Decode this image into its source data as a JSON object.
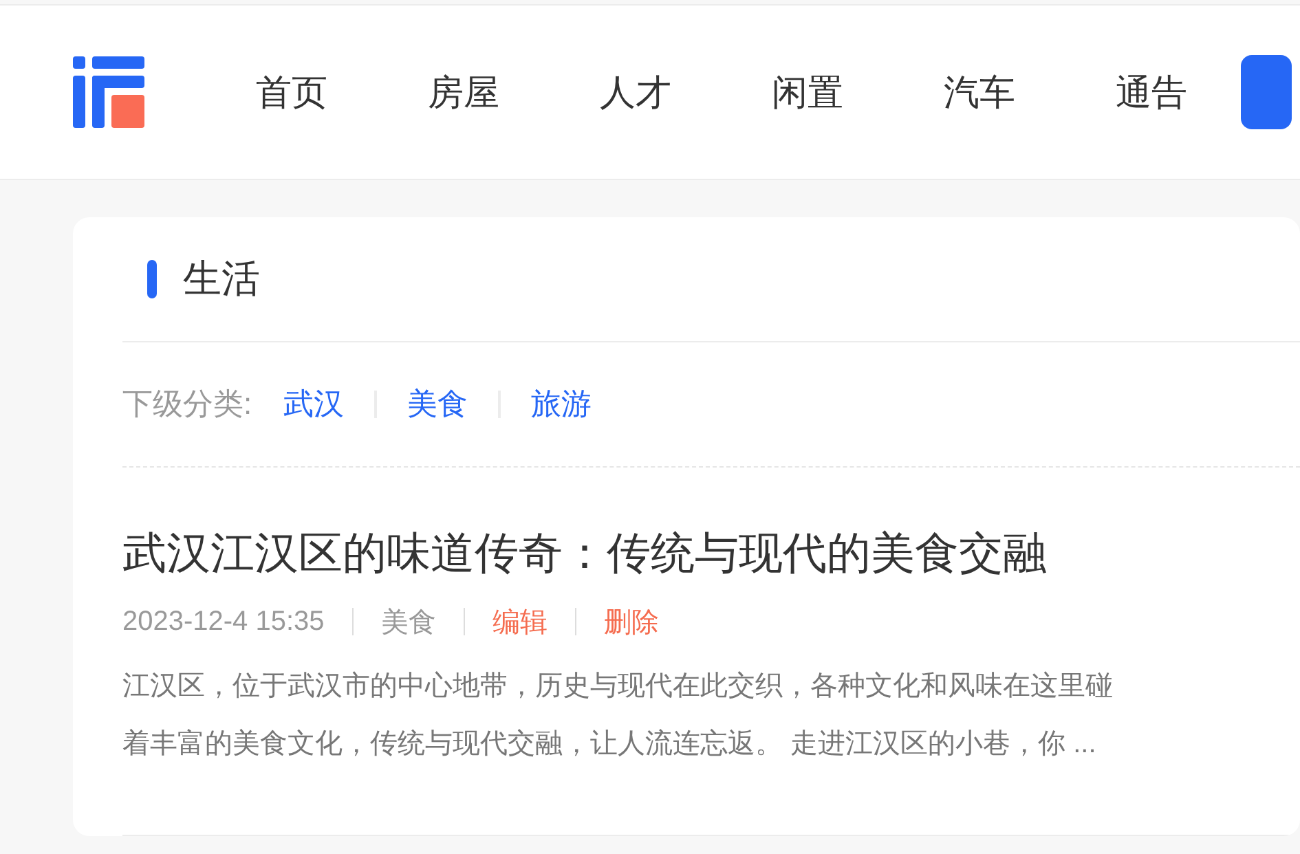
{
  "nav": {
    "items": [
      {
        "label": "首页"
      },
      {
        "label": "房屋"
      },
      {
        "label": "人才"
      },
      {
        "label": "闲置"
      },
      {
        "label": "汽车"
      },
      {
        "label": "通告"
      }
    ]
  },
  "section": {
    "title": "生活",
    "subcategories": {
      "label": "下级分类:",
      "items": [
        "武汉",
        "美食",
        "旅游"
      ]
    },
    "articles": [
      {
        "title": "武汉江汉区的味道传奇：传统与现代的美食交融",
        "meta": [
          {
            "kind": "date",
            "text": "2023-12-4 15:35"
          },
          {
            "kind": "category",
            "text": "美食"
          },
          {
            "kind": "edit",
            "text": "编辑"
          },
          {
            "kind": "delete",
            "text": "删除"
          }
        ],
        "summary_lines": [
          "江汉区，位于武汉市的中心地带，历史与现代在此交织，各种文化和风味在这里碰",
          "着丰富的美食文化，传统与现代交融，让人流连忘返。 走进江汉区的小巷，你 ..."
        ]
      }
    ]
  }
}
